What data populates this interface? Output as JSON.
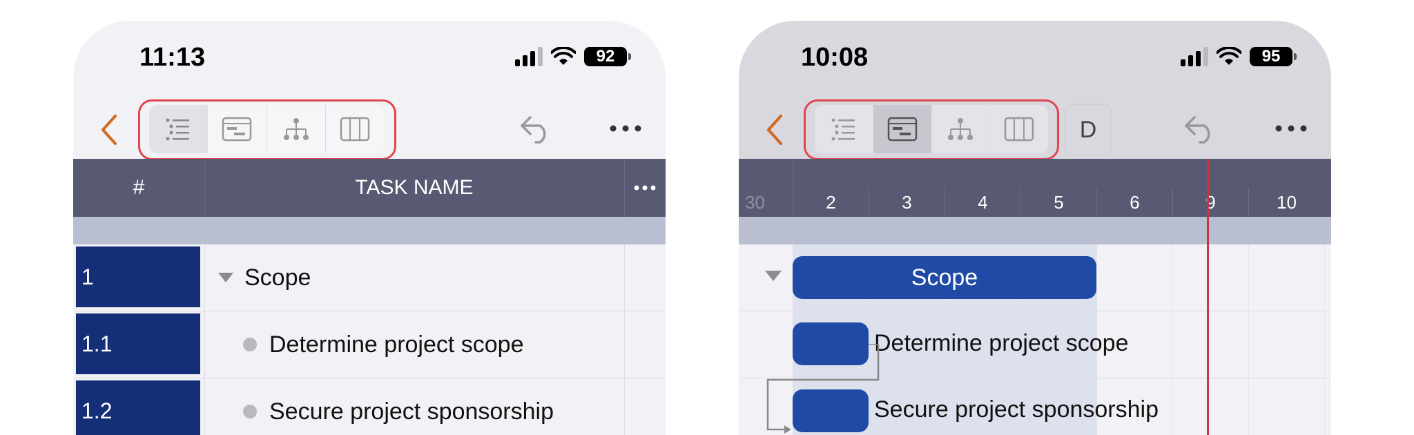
{
  "left": {
    "status": {
      "time": "11:13",
      "battery": "92"
    },
    "toolbar": {
      "view_options": [
        {
          "icon": "list-view-icon",
          "selected": true
        },
        {
          "icon": "gantt-view-icon",
          "selected": false
        },
        {
          "icon": "hierarchy-view-icon",
          "selected": false
        },
        {
          "icon": "board-view-icon",
          "selected": false
        }
      ]
    },
    "table": {
      "col_number": "#",
      "col_task_name": "TASK NAME",
      "rows": [
        {
          "number": "1",
          "name": "Scope",
          "type": "summary"
        },
        {
          "number": "1.1",
          "name": "Determine project scope",
          "type": "task"
        },
        {
          "number": "1.2",
          "name": "Secure project sponsorship",
          "type": "task"
        }
      ]
    }
  },
  "right": {
    "status": {
      "time": "10:08",
      "battery": "95"
    },
    "toolbar": {
      "view_options": [
        {
          "icon": "list-view-icon",
          "selected": false
        },
        {
          "icon": "gantt-view-icon",
          "selected": true
        },
        {
          "icon": "hierarchy-view-icon",
          "selected": false
        },
        {
          "icon": "board-view-icon",
          "selected": false
        }
      ],
      "timescale_label": "D"
    },
    "gantt": {
      "days": [
        "30",
        "2",
        "3",
        "4",
        "5",
        "6",
        "9",
        "10"
      ],
      "bars": [
        {
          "label": "Scope",
          "type": "summary"
        },
        {
          "label": "Determine project scope",
          "type": "task"
        },
        {
          "label": "Secure project sponsorship",
          "type": "task"
        }
      ]
    }
  },
  "colors": {
    "accent": "#d2691e",
    "highlight": "#e0454e",
    "header": "#575a72",
    "bar": "#1f4ba6",
    "row_number": "#152e78",
    "today_line": "#c8353c"
  }
}
